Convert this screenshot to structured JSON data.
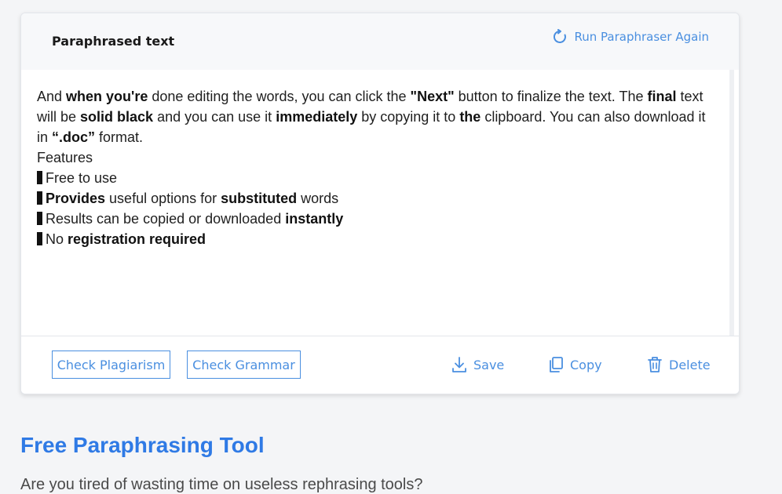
{
  "card": {
    "title": "Paraphrased text",
    "rerun_label": "Run Paraphraser Again"
  },
  "output": {
    "p1": {
      "t1": "And ",
      "b1": "when you're",
      "t2": " done editing the words, you can click the ",
      "b2": "\"Next\"",
      "t3": " button to finalize the text. The ",
      "b3": "final",
      "t4": " text will be ",
      "b4": "solid black",
      "t5": " and you can use it ",
      "b5": "immediately",
      "t6": " by copying it to ",
      "b6": "the",
      "t7": " clipboard. You can also download it in ",
      "b7": "“.doc”",
      "t8": " format."
    },
    "features_heading": "Features",
    "f1": {
      "t1": "Free to use"
    },
    "f2": {
      "b1": "Provides",
      "t1": " useful options for ",
      "b2": "substituted",
      "t2": " words"
    },
    "f3": {
      "t1": "Results can be copied or downloaded ",
      "b1": "instantly"
    },
    "f4": {
      "t1": "No ",
      "b1": "registration required"
    }
  },
  "footer": {
    "check_plagiarism": "Check Plagiarism",
    "check_grammar": "Check Grammar",
    "save": "Save",
    "copy": "Copy",
    "delete": "Delete"
  },
  "section": {
    "title": "Free Paraphrasing Tool",
    "subtitle": "Are you tired of wasting time on useless rephrasing tools?"
  },
  "colors": {
    "accent": "#4a8fe0",
    "heading": "#2f7ae5",
    "background": "#f4f5f7"
  },
  "icons": [
    "refresh-icon",
    "download-icon",
    "copy-icon",
    "trash-icon",
    "bullet-bar-icon"
  ]
}
